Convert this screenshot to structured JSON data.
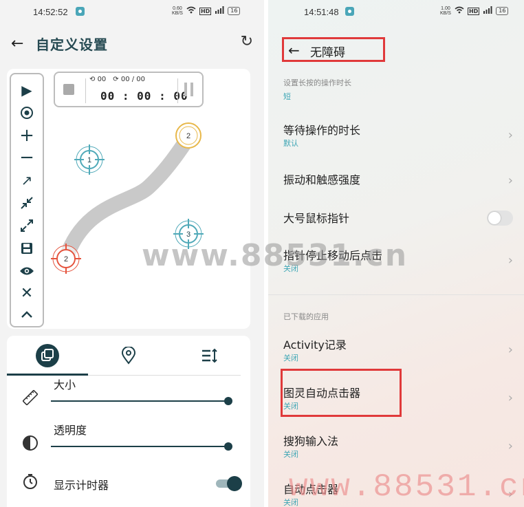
{
  "left": {
    "status": {
      "time": "14:52:52",
      "net_speed": "0.60",
      "net_unit": "KB/S",
      "battery": "16"
    },
    "title": "自定义设置",
    "timer": {
      "loop_count": "00",
      "repeat": "00 / 00",
      "time": "00 : 00 : 00"
    },
    "markers": [
      {
        "label": "1"
      },
      {
        "label": "2"
      },
      {
        "label": "3"
      },
      {
        "label": "2"
      }
    ],
    "settings": {
      "size_label": "大小",
      "size_value": 1.0,
      "opacity_label": "透明度",
      "opacity_value": 1.0,
      "timer_label": "显示计时器",
      "timer_on": true
    }
  },
  "right": {
    "status": {
      "time": "14:51:48",
      "net_speed": "1.00",
      "net_unit": "KB/S",
      "battery": "16"
    },
    "title": "无障碍",
    "long_press_label": "设置长按的操作时长",
    "long_press_value": "短",
    "items_top": [
      {
        "label": "等待操作的时长",
        "value": "默认"
      },
      {
        "label": "振动和触感强度",
        "value": ""
      },
      {
        "label": "大号鼠标指针",
        "value": ""
      },
      {
        "label": "指针停止移动后点击",
        "value": "关闭"
      }
    ],
    "downloaded_label": "已下载的应用",
    "apps": [
      {
        "label": "Activity记录",
        "value": "关闭"
      },
      {
        "label": "图灵自动点击器",
        "value": "关闭"
      },
      {
        "label": "搜狗输入法",
        "value": "关闭"
      },
      {
        "label": "自动点击器",
        "value": "关闭"
      }
    ]
  },
  "watermark_center": "www.88531.cn",
  "watermark_bottom": "www.88531.cn",
  "colors": {
    "accent": "#1c3f48",
    "teal": "#3ea6b5",
    "highlight": "#e0393a"
  }
}
